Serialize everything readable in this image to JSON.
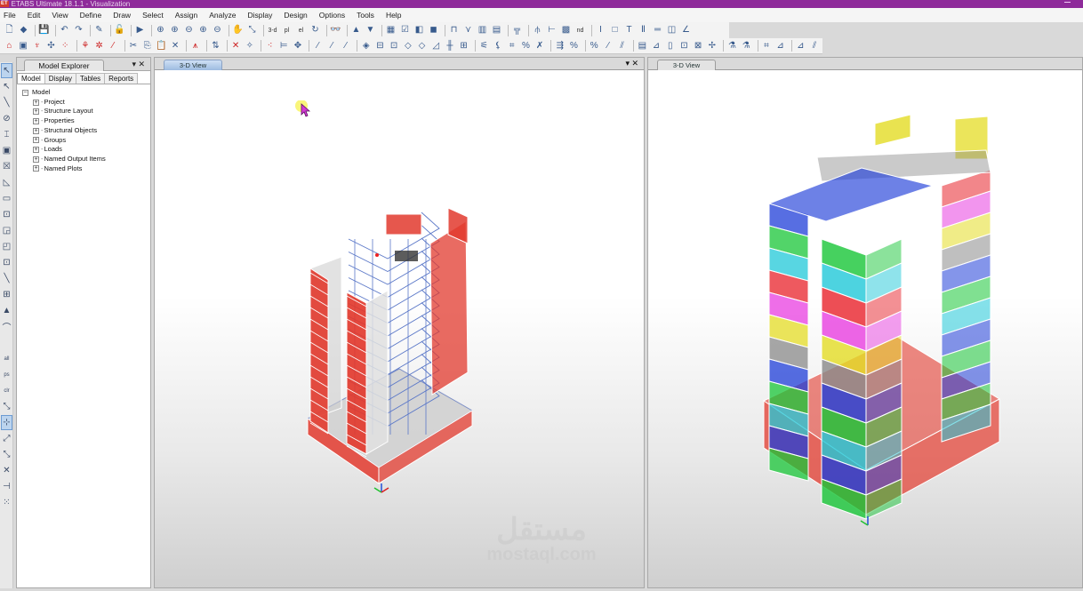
{
  "window": {
    "title": "ETABS Ultimate 18.1.1 - Visualization",
    "logo": "ET"
  },
  "menu": [
    "File",
    "Edit",
    "View",
    "Define",
    "Draw",
    "Select",
    "Assign",
    "Analyze",
    "Display",
    "Design",
    "Options",
    "Tools",
    "Help"
  ],
  "toolbar1": [
    {
      "name": "new-model-icon",
      "glyph": "🗋"
    },
    {
      "name": "open-icon",
      "glyph": "◆"
    },
    {
      "sep": true
    },
    {
      "name": "save-icon",
      "glyph": "💾"
    },
    {
      "sep": true
    },
    {
      "name": "undo-icon",
      "glyph": "↶"
    },
    {
      "name": "redo-icon",
      "glyph": "↷"
    },
    {
      "sep": true
    },
    {
      "name": "edit-pencil-icon",
      "glyph": "✎"
    },
    {
      "sep": true
    },
    {
      "name": "lock-icon",
      "glyph": "🔓"
    },
    {
      "sep": true
    },
    {
      "name": "run-analysis-icon",
      "glyph": "▶"
    },
    {
      "sep": true
    },
    {
      "name": "zoom-window-icon",
      "glyph": "⊕"
    },
    {
      "name": "zoom-in-icon",
      "glyph": "⊕"
    },
    {
      "name": "zoom-out-icon",
      "glyph": "⊖"
    },
    {
      "name": "zoom-extent-icon",
      "glyph": "⊕"
    },
    {
      "name": "zoom-previous-icon",
      "glyph": "⊖"
    },
    {
      "sep": true
    },
    {
      "name": "pan-icon",
      "glyph": "✋"
    },
    {
      "name": "rubber-band-icon",
      "glyph": "⤡"
    },
    {
      "sep": true
    },
    {
      "name": "3d-view-icon",
      "text": "3-d"
    },
    {
      "name": "plan-view-icon",
      "text": "pl"
    },
    {
      "name": "elevation-view-icon",
      "text": "el"
    },
    {
      "name": "rotate-view-icon",
      "glyph": "↻"
    },
    {
      "sep": true
    },
    {
      "name": "perspective-icon",
      "glyph": "👓"
    },
    {
      "sep": true
    },
    {
      "name": "move-up-icon",
      "glyph": "▲"
    },
    {
      "name": "move-down-icon",
      "glyph": "▼"
    },
    {
      "sep": true
    },
    {
      "name": "object-shrink-icon",
      "glyph": "▦"
    },
    {
      "name": "set-display-options-icon",
      "glyph": "☑"
    },
    {
      "name": "building-view-options-icon",
      "glyph": "◧"
    },
    {
      "name": "extrude-icon",
      "glyph": "◼"
    },
    {
      "sep": true
    },
    {
      "name": "draw-frame-icon",
      "glyph": "⊓"
    },
    {
      "name": "draw-brace-icon",
      "glyph": "⋎"
    },
    {
      "name": "draw-wall-icon",
      "glyph": "▥"
    },
    {
      "name": "draw-wall-stack-icon",
      "glyph": "▤"
    },
    {
      "sep": true
    },
    {
      "name": "draw-column-icon",
      "glyph": "╦"
    },
    {
      "sep": true
    },
    {
      "name": "draw-link-icon",
      "glyph": "⫛"
    },
    {
      "name": "draw-beam-icon",
      "glyph": "⊢"
    },
    {
      "name": "draw-panel-icon",
      "glyph": "▩"
    },
    {
      "name": "draw-nd-icon",
      "text": "nd"
    },
    {
      "sep": true
    },
    {
      "name": "select-section-icon",
      "glyph": "I"
    },
    {
      "name": "area-section-icon",
      "glyph": "□"
    },
    {
      "name": "frame-section-icon",
      "glyph": "T"
    },
    {
      "name": "column-section-icon",
      "glyph": "Ⅱ"
    },
    {
      "name": "line-style-icon",
      "glyph": "═"
    },
    {
      "name": "rebar-icon",
      "glyph": "◫"
    },
    {
      "name": "dimension-icon",
      "glyph": "∠"
    }
  ],
  "toolbar2": [
    {
      "name": "assign-joint-restraint-icon",
      "glyph": "⌂"
    },
    {
      "name": "assign-diaphragm-icon",
      "glyph": "▣"
    },
    {
      "name": "assign-spring-icon",
      "glyph": "♆"
    },
    {
      "name": "assign-panel-zone-icon",
      "glyph": "✣"
    },
    {
      "name": "assign-joint-load-icon",
      "glyph": "⁘"
    },
    {
      "sep": true
    },
    {
      "name": "assign-frame-load-icon",
      "glyph": "⚘"
    },
    {
      "name": "assign-point-load-icon",
      "glyph": "✲"
    },
    {
      "name": "assign-line-load-icon",
      "glyph": "⁄"
    },
    {
      "sep": true
    },
    {
      "name": "cut-icon",
      "glyph": "✂"
    },
    {
      "name": "copy-icon",
      "glyph": "⎘"
    },
    {
      "name": "paste-icon",
      "glyph": "📋"
    },
    {
      "name": "delete-icon",
      "glyph": "✕"
    },
    {
      "sep": true
    },
    {
      "name": "replicate-icon",
      "glyph": "⩚"
    },
    {
      "sep": true
    },
    {
      "name": "align-icon",
      "glyph": "⇅"
    },
    {
      "sep": true
    },
    {
      "name": "divide-frames-icon",
      "glyph": "✕"
    },
    {
      "name": "merge-icon",
      "glyph": "✧"
    },
    {
      "sep": true
    },
    {
      "name": "snap-points-icon",
      "glyph": "⁖"
    },
    {
      "name": "snap-ends-icon",
      "glyph": "⊨"
    },
    {
      "name": "snap-middle-icon",
      "glyph": "✥"
    },
    {
      "sep": true
    },
    {
      "name": "snap-intersection-icon",
      "glyph": "⁄"
    },
    {
      "name": "snap-perpendicular-icon",
      "glyph": "⁄"
    },
    {
      "name": "snap-lines-icon",
      "glyph": "⁄"
    },
    {
      "sep": true
    },
    {
      "name": "assign-area-icon",
      "glyph": "◈"
    },
    {
      "name": "assign-opening-icon",
      "glyph": "⊟"
    },
    {
      "name": "assign-wall-icon",
      "glyph": "⊡"
    },
    {
      "name": "assign-slab-icon",
      "glyph": "◇"
    },
    {
      "name": "assign-deck-icon",
      "glyph": "◇"
    },
    {
      "name": "assign-shell-icon",
      "glyph": "◿"
    },
    {
      "name": "assign-pier-icon",
      "glyph": "╫"
    },
    {
      "name": "assign-spandrel-icon",
      "glyph": "⊞"
    },
    {
      "sep": true
    },
    {
      "name": "frame-release-icon",
      "glyph": "⚟"
    },
    {
      "name": "frame-offset-icon",
      "glyph": "⚸"
    },
    {
      "name": "frame-hinge-icon",
      "glyph": "⌗"
    },
    {
      "name": "frame-modifier-icon",
      "glyph": "%"
    },
    {
      "name": "frame-local-axes-icon",
      "glyph": "✗"
    },
    {
      "sep": true
    },
    {
      "name": "area-modifier-icon",
      "glyph": "⇶"
    },
    {
      "name": "area-local-axes-icon",
      "glyph": "%"
    },
    {
      "sep": true
    },
    {
      "name": "link-property-icon",
      "glyph": "%"
    },
    {
      "name": "link-local-axes-icon",
      "glyph": "⁄"
    },
    {
      "name": "tendon-icon",
      "glyph": "⫽"
    },
    {
      "sep": true
    },
    {
      "name": "show-tables-icon",
      "glyph": "▤"
    },
    {
      "name": "show-forces-icon",
      "glyph": "⊿"
    },
    {
      "name": "show-deformed-icon",
      "glyph": "▯"
    },
    {
      "name": "show-story-response-icon",
      "glyph": "⊡"
    },
    {
      "name": "show-mode-shape-icon",
      "glyph": "⊠"
    },
    {
      "name": "show-hinge-results-icon",
      "glyph": "✢"
    },
    {
      "sep": true
    },
    {
      "name": "design-steel-icon",
      "glyph": "⚗"
    },
    {
      "name": "design-concrete-icon",
      "glyph": "⚗"
    },
    {
      "sep": true
    },
    {
      "name": "design-composite-icon",
      "glyph": "⌗"
    },
    {
      "name": "design-wall-icon",
      "glyph": "⊿"
    },
    {
      "sep": true
    },
    {
      "name": "design-slab-icon",
      "glyph": "⊿"
    },
    {
      "name": "design-check-icon",
      "glyph": "⫽"
    }
  ],
  "left_tools": [
    {
      "name": "select-pointer-icon",
      "glyph": "↖",
      "selected": true
    },
    {
      "name": "reshape-icon",
      "glyph": "↖"
    },
    {
      "name": "draw-line-icon",
      "glyph": "╲"
    },
    {
      "name": "draw-beam-region-icon",
      "glyph": "⊘"
    },
    {
      "name": "draw-column-region-icon",
      "glyph": "⌶"
    },
    {
      "name": "draw-brace-region-icon",
      "glyph": "▣"
    },
    {
      "name": "draw-x-brace-icon",
      "glyph": "☒"
    },
    {
      "name": "draw-poly-area-icon",
      "glyph": "◺"
    },
    {
      "name": "draw-rect-area-icon",
      "glyph": "▭"
    },
    {
      "name": "draw-click-area-icon",
      "glyph": "⊡"
    },
    {
      "name": "draw-wall-opening-icon",
      "glyph": "◲"
    },
    {
      "name": "draw-wall-region-icon",
      "glyph": "◰"
    },
    {
      "name": "draw-window-icon",
      "glyph": "⊡"
    },
    {
      "name": "draw-link-icon",
      "glyph": "╲"
    },
    {
      "name": "draw-grid-icon",
      "glyph": "⊞"
    },
    {
      "name": "draw-tendon-icon",
      "glyph": "▲"
    },
    {
      "name": "draw-curve-icon",
      "glyph": "⌒"
    },
    {
      "name": "blank-1",
      "glyph": ""
    },
    {
      "name": "select-all-icon",
      "glyph": "all"
    },
    {
      "name": "select-previous-icon",
      "glyph": "ps"
    },
    {
      "name": "clear-selection-icon",
      "glyph": "clr"
    },
    {
      "name": "select-intersect-icon",
      "glyph": "⤡"
    },
    {
      "name": "snap-joint-icon",
      "glyph": "⊹",
      "selected": true
    },
    {
      "name": "snap-line-end-icon",
      "glyph": "⤢"
    },
    {
      "name": "snap-middle-icon",
      "glyph": "⤡"
    },
    {
      "name": "snap-intersect-icon",
      "glyph": "✕"
    },
    {
      "name": "snap-perpendicular-icon",
      "glyph": "⊣"
    },
    {
      "name": "snap-grid-icon",
      "glyph": "⁙"
    }
  ],
  "explorer": {
    "title": "Model Explorer",
    "controls": "▾ ✕",
    "tabs": [
      "Model",
      "Display",
      "Tables",
      "Reports"
    ],
    "active_tab": "Model",
    "root": "Model",
    "items": [
      "Project",
      "Structure Layout",
      "Properties",
      "Structural Objects",
      "Groups",
      "Loads",
      "Named Output Items",
      "Named Plots"
    ]
  },
  "views": [
    {
      "tab": "3-D View",
      "controls": "▾ ✕",
      "active": true,
      "render": "extruded-red-walls"
    },
    {
      "tab": "3-D View",
      "active": false,
      "render": "colored-by-story"
    }
  ],
  "watermark": {
    "arabic": "مستقل",
    "latin": "mostaql.com"
  },
  "colors": {
    "title_bar": "#8e2a9a",
    "wall_red": "#e23a2e",
    "frame_blue": "#5b78c8",
    "story_colors": [
      "#1f3ed8",
      "#18c637",
      "#20c8d8",
      "#e8222a",
      "#e83ee0",
      "#e4dc24",
      "#8a8a8a"
    ]
  }
}
